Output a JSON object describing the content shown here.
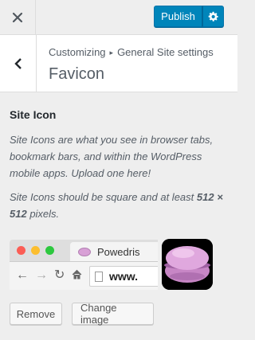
{
  "topbar": {
    "close_icon": "close-icon",
    "publish_label": "Publish",
    "settings_icon": "gear-icon",
    "accent": "#0085ba"
  },
  "section": {
    "breadcrumb_root": "Customizing",
    "breadcrumb_separator": "▸",
    "breadcrumb_parent": "General Site settings",
    "title": "Favicon",
    "back_icon": "chevron-left-icon"
  },
  "control": {
    "title": "Site Icon",
    "description": "Site Icons are what you see in browser tabs, bookmark bars, and within the WordPress mobile apps. Upload one here!",
    "size_note_prefix": "Site Icons should be square and at least ",
    "size_note_size": "512 × 512",
    "size_note_suffix": " pixels."
  },
  "preview": {
    "tab_title": "Powedris",
    "url_text": "www.",
    "favicon_image": "pink-macaron",
    "app_icon_image": "pink-macaron"
  },
  "actions": {
    "remove_label": "Remove",
    "change_label": "Change image"
  }
}
